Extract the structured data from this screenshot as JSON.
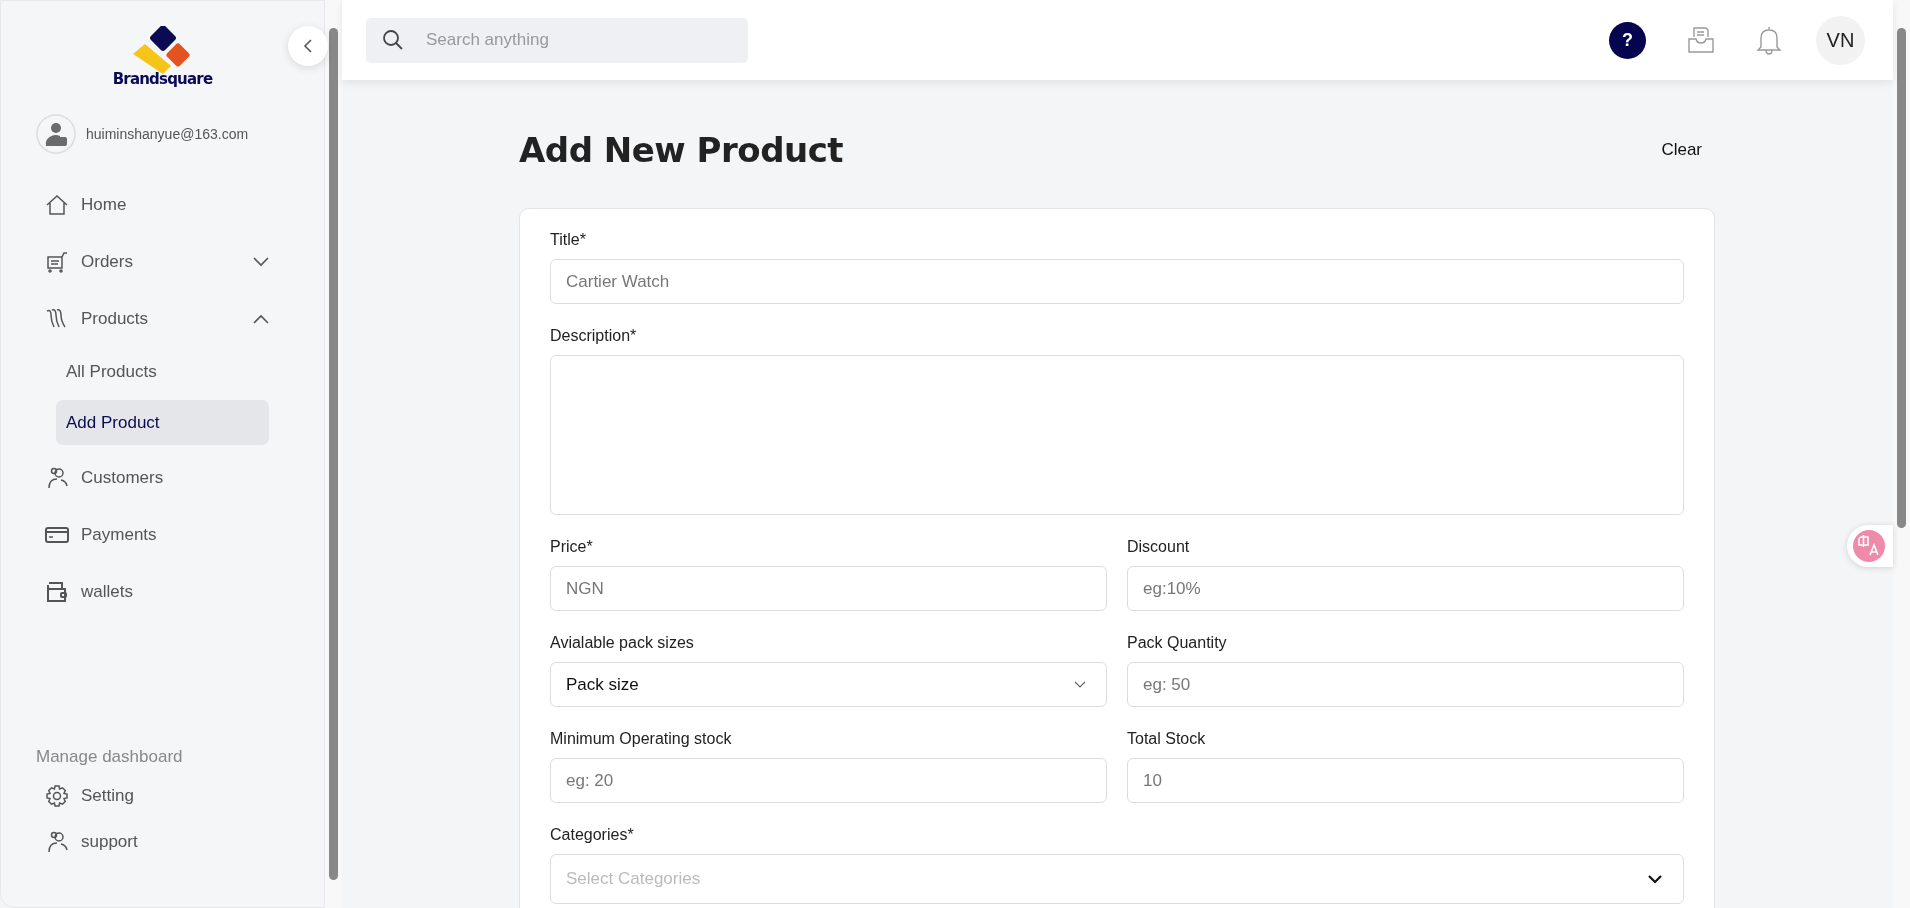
{
  "sidebar": {
    "logo_text": "Brandsquare",
    "user_email": "huiminshanyue@163.com",
    "nav": [
      {
        "label": "Home",
        "kind": "home"
      },
      {
        "label": "Orders",
        "kind": "cart",
        "expanded": false
      },
      {
        "label": "Products",
        "kind": "products",
        "expanded": true,
        "children": [
          {
            "label": "All Products",
            "selected": false
          },
          {
            "label": "Add Product",
            "selected": true
          }
        ]
      },
      {
        "label": "Customers",
        "kind": "people"
      },
      {
        "label": "Payments",
        "kind": "card"
      },
      {
        "label": "wallets",
        "kind": "wallet"
      }
    ],
    "section_title": "Manage dashboard",
    "footer_nav": [
      {
        "label": "Setting",
        "kind": "gear"
      },
      {
        "label": "support",
        "kind": "people"
      }
    ]
  },
  "header": {
    "search": {
      "placeholder": "Search anything"
    },
    "help": "?",
    "avatar": "VN"
  },
  "page": {
    "title": "Add New Product",
    "clear": "Clear"
  },
  "form": {
    "rows": [
      [
        {
          "kind": "input",
          "label": "Title*",
          "placeholder": "Cartier Watch"
        }
      ],
      [
        {
          "kind": "textarea",
          "label": "Description*"
        }
      ],
      [
        {
          "kind": "input",
          "label": "Price*",
          "placeholder": "NGN"
        },
        {
          "kind": "input",
          "label": "Discount",
          "placeholder": "eg:10%"
        }
      ],
      [
        {
          "kind": "select",
          "label": "Avialable pack sizes",
          "value": "Pack size"
        },
        {
          "kind": "input",
          "label": "Pack Quantity",
          "placeholder": "eg: 50"
        }
      ],
      [
        {
          "kind": "input",
          "label": "Minimum Operating stock",
          "placeholder": "eg: 20"
        },
        {
          "kind": "input",
          "label": "Total Stock",
          "placeholder": "10"
        }
      ],
      [
        {
          "kind": "dropdown",
          "label": "Categories*",
          "placeholder": "Select Categories"
        }
      ]
    ]
  }
}
